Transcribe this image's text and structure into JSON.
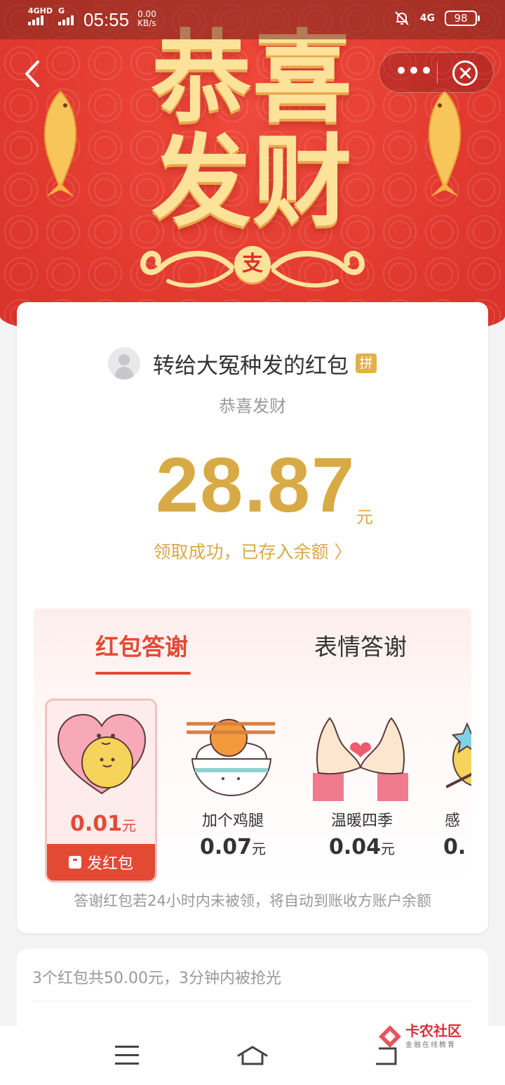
{
  "status_bar": {
    "network1": "4GHD",
    "network2": "G",
    "time": "05:55",
    "speed_value": "0.00",
    "speed_unit": "KB/s",
    "network3": "4G",
    "battery": "98"
  },
  "banner": {
    "headline_line1": "恭喜",
    "headline_line2": "发财",
    "logo_char": "支"
  },
  "card": {
    "sender_name": "转给大冤种发的红包",
    "pin_badge": "拼",
    "wish_text": "恭喜发财",
    "amount": "28.87",
    "amount_unit": "元",
    "success_text": "领取成功，已存入余额 〉"
  },
  "thanks": {
    "tab_active": "红包答谢",
    "tab_inactive": "表情答谢",
    "gifts": [
      {
        "name": "",
        "price": "0.01",
        "unit": "元"
      },
      {
        "name": "加个鸡腿",
        "price": "0.07",
        "unit": "元"
      },
      {
        "name": "温暖四季",
        "price": "0.04",
        "unit": "元"
      },
      {
        "name": "感",
        "price": "0.",
        "unit": ""
      }
    ],
    "send_button": "发红包",
    "note": "答谢红包若24小时内未被领，将自动到账收方账户余额"
  },
  "summary": {
    "text": "3个红包共50.00元，3分钟内被抢光"
  },
  "watermark": {
    "title": "卡农社区",
    "subtitle": "金融在线教育"
  },
  "colors": {
    "banner_red": "#e23a2f",
    "gold": "#d8aa45",
    "accent_red": "#e34a34"
  }
}
